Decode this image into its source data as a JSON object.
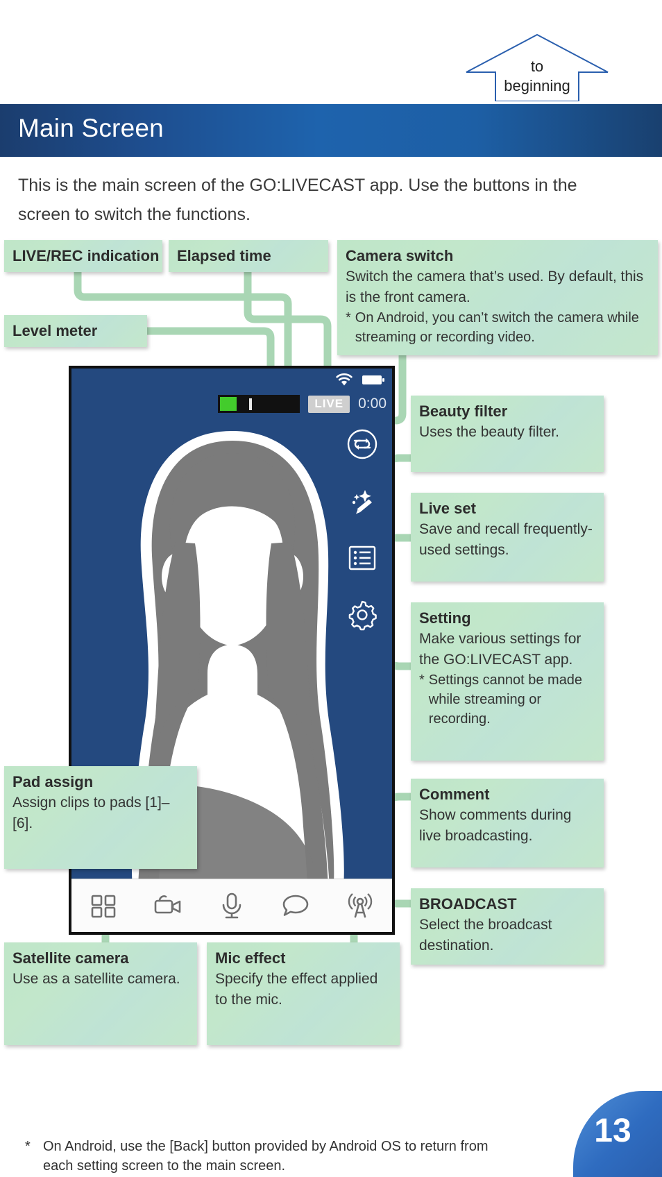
{
  "header": {
    "to_beginning_line1": "to",
    "to_beginning_line2": "beginning",
    "title": "Main Screen"
  },
  "intro": "This is the main screen of the GO:LIVECAST app. Use the buttons in the screen to switch the functions.",
  "callouts": {
    "live_rec": {
      "title": "LIVE/REC indication"
    },
    "elapsed_time": {
      "title": "Elapsed time"
    },
    "level_meter": {
      "title": "Level meter"
    },
    "camera_switch": {
      "title": "Camera switch",
      "body": "Switch the camera that’s used. By default, this is the front camera.",
      "note_star": "*",
      "note": "On Android, you can’t switch the camera while streaming or recording video."
    },
    "beauty_filter": {
      "title": "Beauty filter",
      "body": "Uses the beauty filter."
    },
    "live_set": {
      "title": "Live set",
      "body": "Save and recall frequently-used settings."
    },
    "setting": {
      "title": "Setting",
      "body": "Make various settings for the GO:LIVECAST app.",
      "note_star": "*",
      "note": "Settings cannot be made while streaming or recording."
    },
    "pad_assign": {
      "title": "Pad assign",
      "body": "Assign clips to pads [1]–[6]."
    },
    "comment": {
      "title": "Comment",
      "body": "Show comments during live broadcasting."
    },
    "broadcast": {
      "title": "BROADCAST",
      "body": "Select the broadcast destination."
    },
    "satellite_camera": {
      "title": "Satellite camera",
      "body": "Use as a satellite camera."
    },
    "mic_effect": {
      "title": "Mic effect",
      "body": "Specify the effect applied to the mic."
    }
  },
  "phone": {
    "status": {
      "wifi_icon": "wifi-icon",
      "battery_icon": "battery-icon"
    },
    "live_badge": "LIVE",
    "elapsed": "0:00",
    "side_icons": [
      "camera-switch-icon",
      "beauty-filter-icon",
      "live-set-icon",
      "setting-gear-icon"
    ],
    "bottom_icons": [
      "pad-assign-icon",
      "satellite-camera-icon",
      "mic-effect-icon",
      "comment-icon",
      "broadcast-icon"
    ]
  },
  "footer": {
    "note_star": "*",
    "note": "On Android, use the [Back] button provided by Android OS to return from each setting screen to the main screen.",
    "page_number": "13"
  },
  "colors": {
    "band_blue": "#1e63ad",
    "callout_green": "#bfe6c8",
    "connector_green": "#a9d6b4",
    "phone_bg": "#24497f",
    "meter_green": "#43cc2c"
  }
}
